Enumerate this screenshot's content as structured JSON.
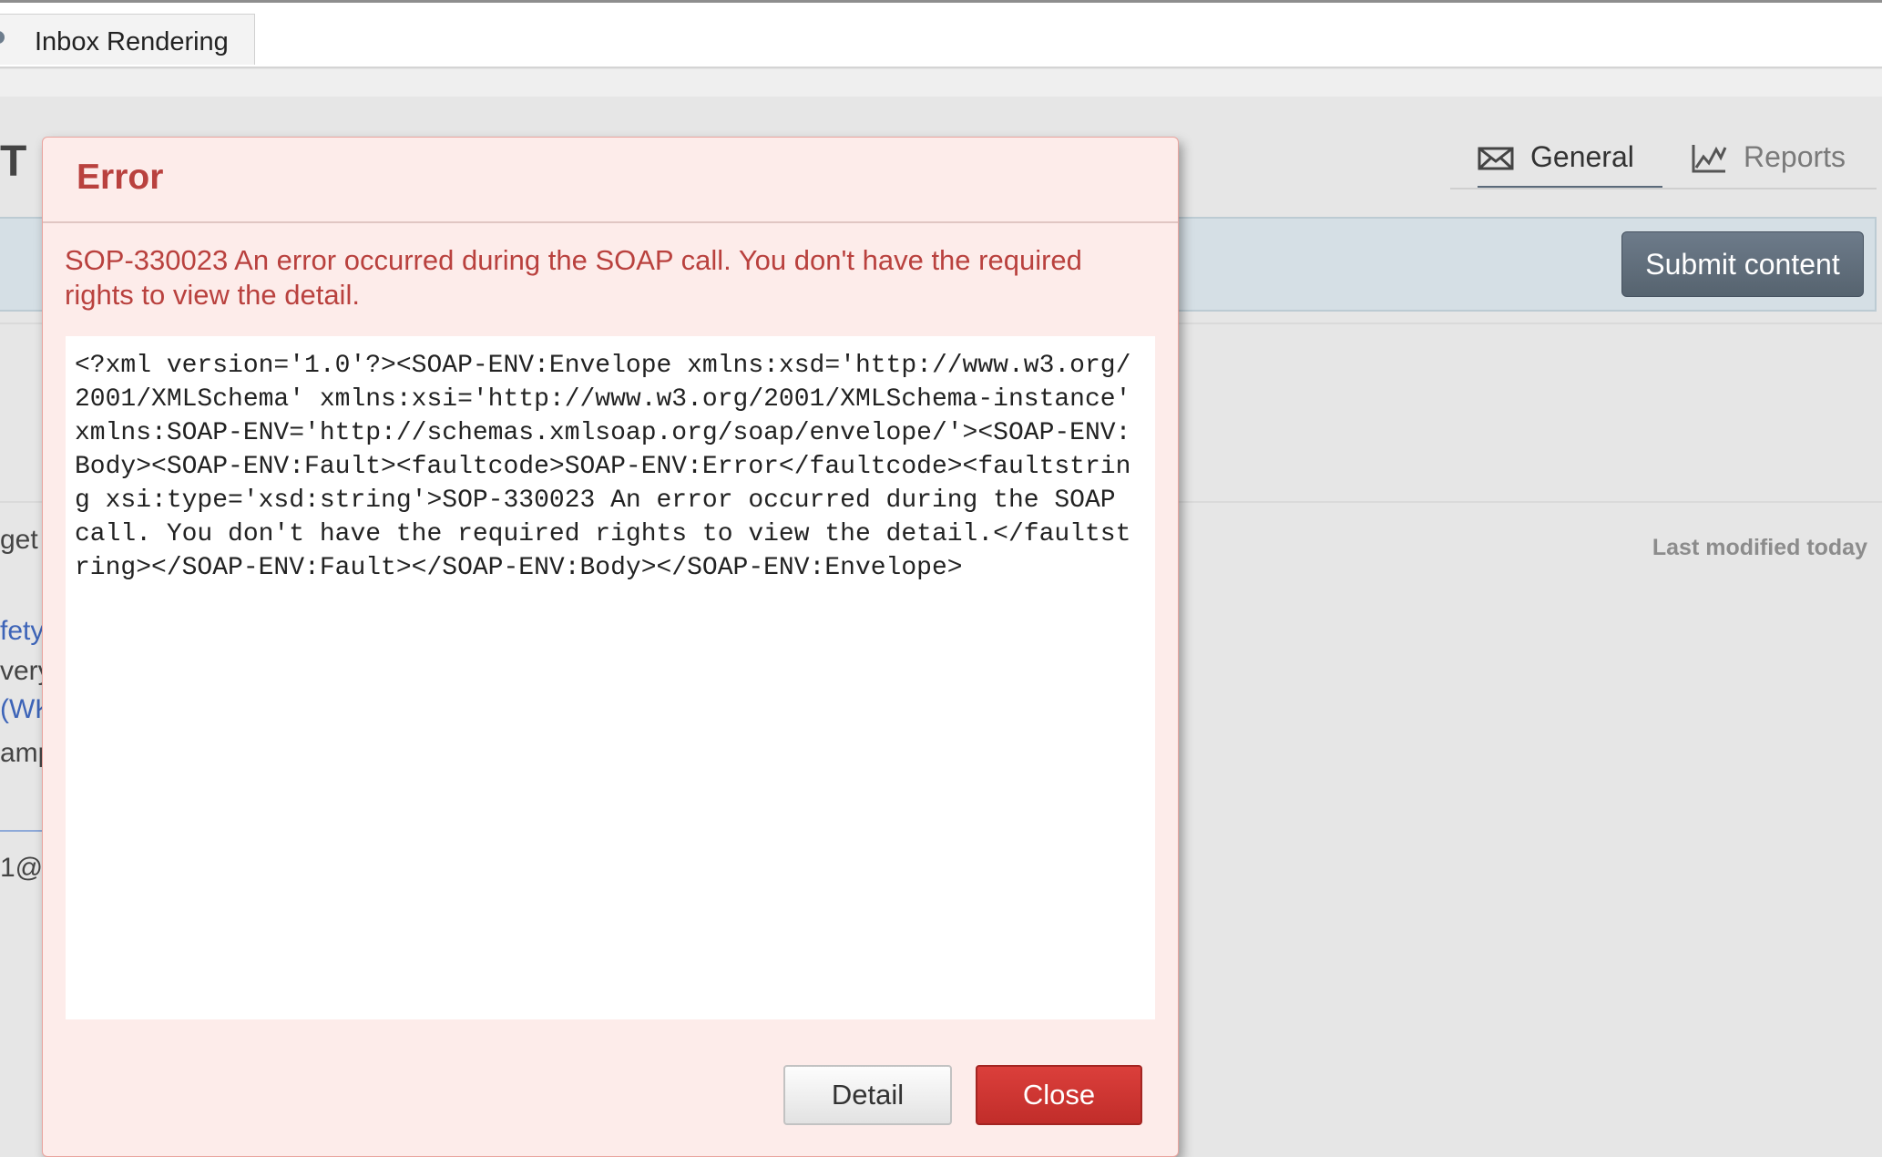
{
  "browser_tab": {
    "label": "Inbox Rendering"
  },
  "app": {
    "title_fragment": "T"
  },
  "nav": {
    "general_label": "General",
    "reports_label": "Reports"
  },
  "toolbar": {
    "submit_label": "Submit content"
  },
  "content": {
    "last_modified": "Last modified today",
    "fragments": [
      "get r",
      "fety",
      "very",
      "(WK",
      "amp",
      "1@"
    ]
  },
  "dialog": {
    "title": "Error",
    "message": "SOP-330023 An error occurred during the SOAP call. You don't have the required rights to view the detail.",
    "xml": "<?xml version='1.0'?><SOAP-ENV:Envelope xmlns:xsd='http://www.w3.org/2001/XMLSchema' xmlns:xsi='http://www.w3.org/2001/XMLSchema-instance' xmlns:SOAP-ENV='http://schemas.xmlsoap.org/soap/envelope/'><SOAP-ENV:Body><SOAP-ENV:Fault><faultcode>SOAP-ENV:Error</faultcode><faultstring xsi:type='xsd:string'>SOP-330023 An error occurred during the SOAP call. You don't have the required rights to view the detail.</faultstring></SOAP-ENV:Fault></SOAP-ENV:Body></SOAP-ENV:Envelope>",
    "detail_label": "Detail",
    "close_label": "Close"
  }
}
